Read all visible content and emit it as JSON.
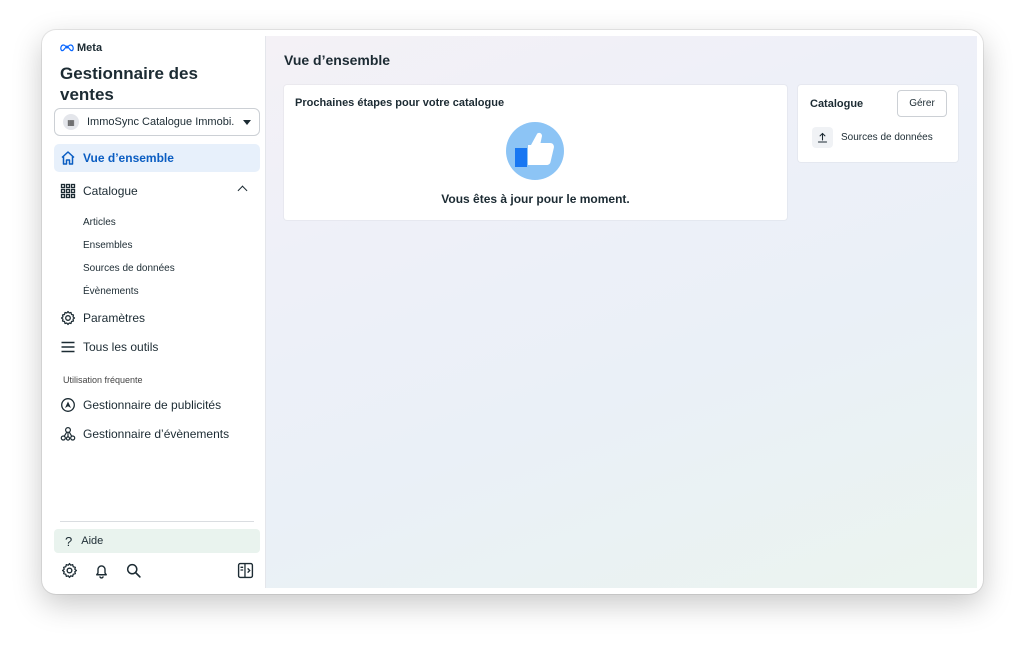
{
  "brand": {
    "logo_text": "Meta"
  },
  "app": {
    "title": "Gestionnaire des ventes"
  },
  "catalog_selector": {
    "value": "ImmoSync Catalogue Immobi..."
  },
  "nav": {
    "overview": "Vue d’ensemble",
    "catalog": "Catalogue",
    "catalog_sub": [
      "Articles",
      "Ensembles",
      "Sources de données",
      "Évènements"
    ],
    "settings": "Paramètres",
    "all_tools": "Tous les outils"
  },
  "frequent": {
    "label": "Utilisation fréquente",
    "items": [
      "Gestionnaire de publicités",
      "Gestionnaire d’évènements"
    ]
  },
  "footer": {
    "help": "Aide"
  },
  "main": {
    "page_title": "Vue d’ensemble",
    "next_steps": {
      "title": "Prochaines étapes pour votre catalogue",
      "message": "Vous êtes à jour pour le moment."
    },
    "catalog_card": {
      "title": "Catalogue",
      "manage_label": "Gérer",
      "data_sources_label": "Sources de données"
    }
  },
  "colors": {
    "accent": "#0a5dc2",
    "active_bg": "#e7f0fb",
    "thumb_circle": "#8cc4f5",
    "thumb_blue": "#1877f2"
  }
}
